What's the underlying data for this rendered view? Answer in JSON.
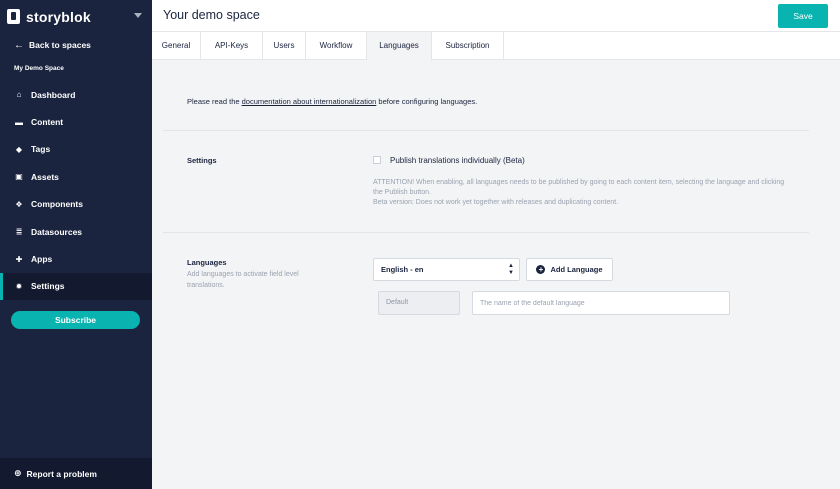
{
  "brand": {
    "name": "storyblok"
  },
  "sidebar": {
    "back_label": "Back to spaces",
    "space_name": "My Demo Space",
    "items": [
      {
        "label": "Dashboard",
        "icon": "home-icon"
      },
      {
        "label": "Content",
        "icon": "folder-icon"
      },
      {
        "label": "Tags",
        "icon": "tags-icon"
      },
      {
        "label": "Assets",
        "icon": "image-icon"
      },
      {
        "label": "Components",
        "icon": "cubes-icon"
      },
      {
        "label": "Datasources",
        "icon": "database-icon"
      },
      {
        "label": "Apps",
        "icon": "puzzle-icon"
      },
      {
        "label": "Settings",
        "icon": "gear-icon",
        "active": true
      }
    ],
    "subscribe_label": "Subscribe",
    "report_label": "Report a problem"
  },
  "header": {
    "title": "Your demo space",
    "save_label": "Save"
  },
  "tabs": [
    {
      "label": "General"
    },
    {
      "label": "API-Keys"
    },
    {
      "label": "Users"
    },
    {
      "label": "Workflow"
    },
    {
      "label": "Languages",
      "active": true
    },
    {
      "label": "Subscription"
    }
  ],
  "main": {
    "intro_before": "Please read the ",
    "intro_link": "documentation about internationalization",
    "intro_after": " before configuring languages.",
    "settings": {
      "label": "Settings",
      "checkbox_label": "Publish translations individually (Beta)",
      "checkbox_checked": false,
      "warning_line1": "ATTENTION! When enabling, all languages needs to be published by going to each content item, selecting the language and clicking the Publish button.",
      "warning_line2": "Beta version: Does not work yet together with releases and duplicating content."
    },
    "languages": {
      "label": "Languages",
      "description": "Add languages to activate field level translations.",
      "selected_language": "English - en",
      "add_label": "Add Language",
      "default_label": "Default",
      "name_placeholder": "The name of the default language",
      "name_value": ""
    }
  },
  "colors": {
    "accent": "#09b3af",
    "sidebar_bg": "#1b243f",
    "text": "#1b243f",
    "muted": "#9aa2b1"
  }
}
